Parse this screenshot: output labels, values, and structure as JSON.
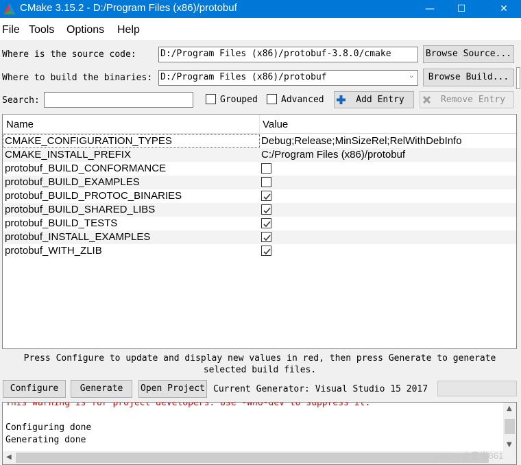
{
  "window": {
    "title": "CMake 3.15.2 - D:/Program Files (x86)/protobuf",
    "controls": {
      "minimize": "—",
      "maximize": "☐",
      "close": "✕"
    }
  },
  "menu": [
    {
      "label": "File"
    },
    {
      "label": "Tools"
    },
    {
      "label": "Options"
    },
    {
      "label": "Help"
    }
  ],
  "source": {
    "label": "Where is the source code:",
    "value": "D:/Program Files (x86)/protobuf-3.8.0/cmake",
    "browse": "Browse Source..."
  },
  "build": {
    "label": "Where to build the binaries:",
    "value": "D:/Program Files (x86)/protobuf",
    "browse": "Browse Build..."
  },
  "search": {
    "label": "Search:",
    "value": "",
    "grouped_label": "Grouped",
    "advanced_label": "Advanced",
    "add_entry": "Add Entry",
    "remove_entry": "Remove Entry"
  },
  "table": {
    "columns": [
      "Name",
      "Value"
    ],
    "rows": [
      {
        "name": "CMAKE_CONFIGURATION_TYPES",
        "value": "Debug;Release;MinSizeRel;RelWithDebInfo"
      },
      {
        "name": "CMAKE_INSTALL_PREFIX",
        "value": "C:/Program Files (x86)/protobuf"
      },
      {
        "name": "protobuf_BUILD_CONFORMANCE",
        "checked": false
      },
      {
        "name": "protobuf_BUILD_EXAMPLES",
        "checked": false
      },
      {
        "name": "protobuf_BUILD_PROTOC_BINARIES",
        "checked": true
      },
      {
        "name": "protobuf_BUILD_SHARED_LIBS",
        "checked": true
      },
      {
        "name": "protobuf_BUILD_TESTS",
        "checked": true
      },
      {
        "name": "protobuf_INSTALL_EXAMPLES",
        "checked": true
      },
      {
        "name": "protobuf_WITH_ZLIB",
        "checked": true
      }
    ]
  },
  "hint": {
    "line1": "Press Configure to update and display new values in red, then press Generate to generate",
    "line2": "selected build files."
  },
  "actions": {
    "configure": "Configure",
    "generate": "Generate",
    "open_project": "Open Project",
    "generator": "Current Generator: Visual Studio 15 2017"
  },
  "output": {
    "lines": [
      {
        "text": "This warning is for project developers.  Use -Wno-dev to suppress it.",
        "color": "#e00000"
      },
      {
        "text": "",
        "color": "#000000"
      },
      {
        "text": "Configuring done",
        "color": "#000000"
      },
      {
        "text": "Generating done",
        "color": "#000000"
      }
    ]
  },
  "watermark": "CSDN @麦当861",
  "colors": {
    "titlebar": "#0078d7",
    "warning": "#e00000",
    "checkmark": "#333333"
  }
}
